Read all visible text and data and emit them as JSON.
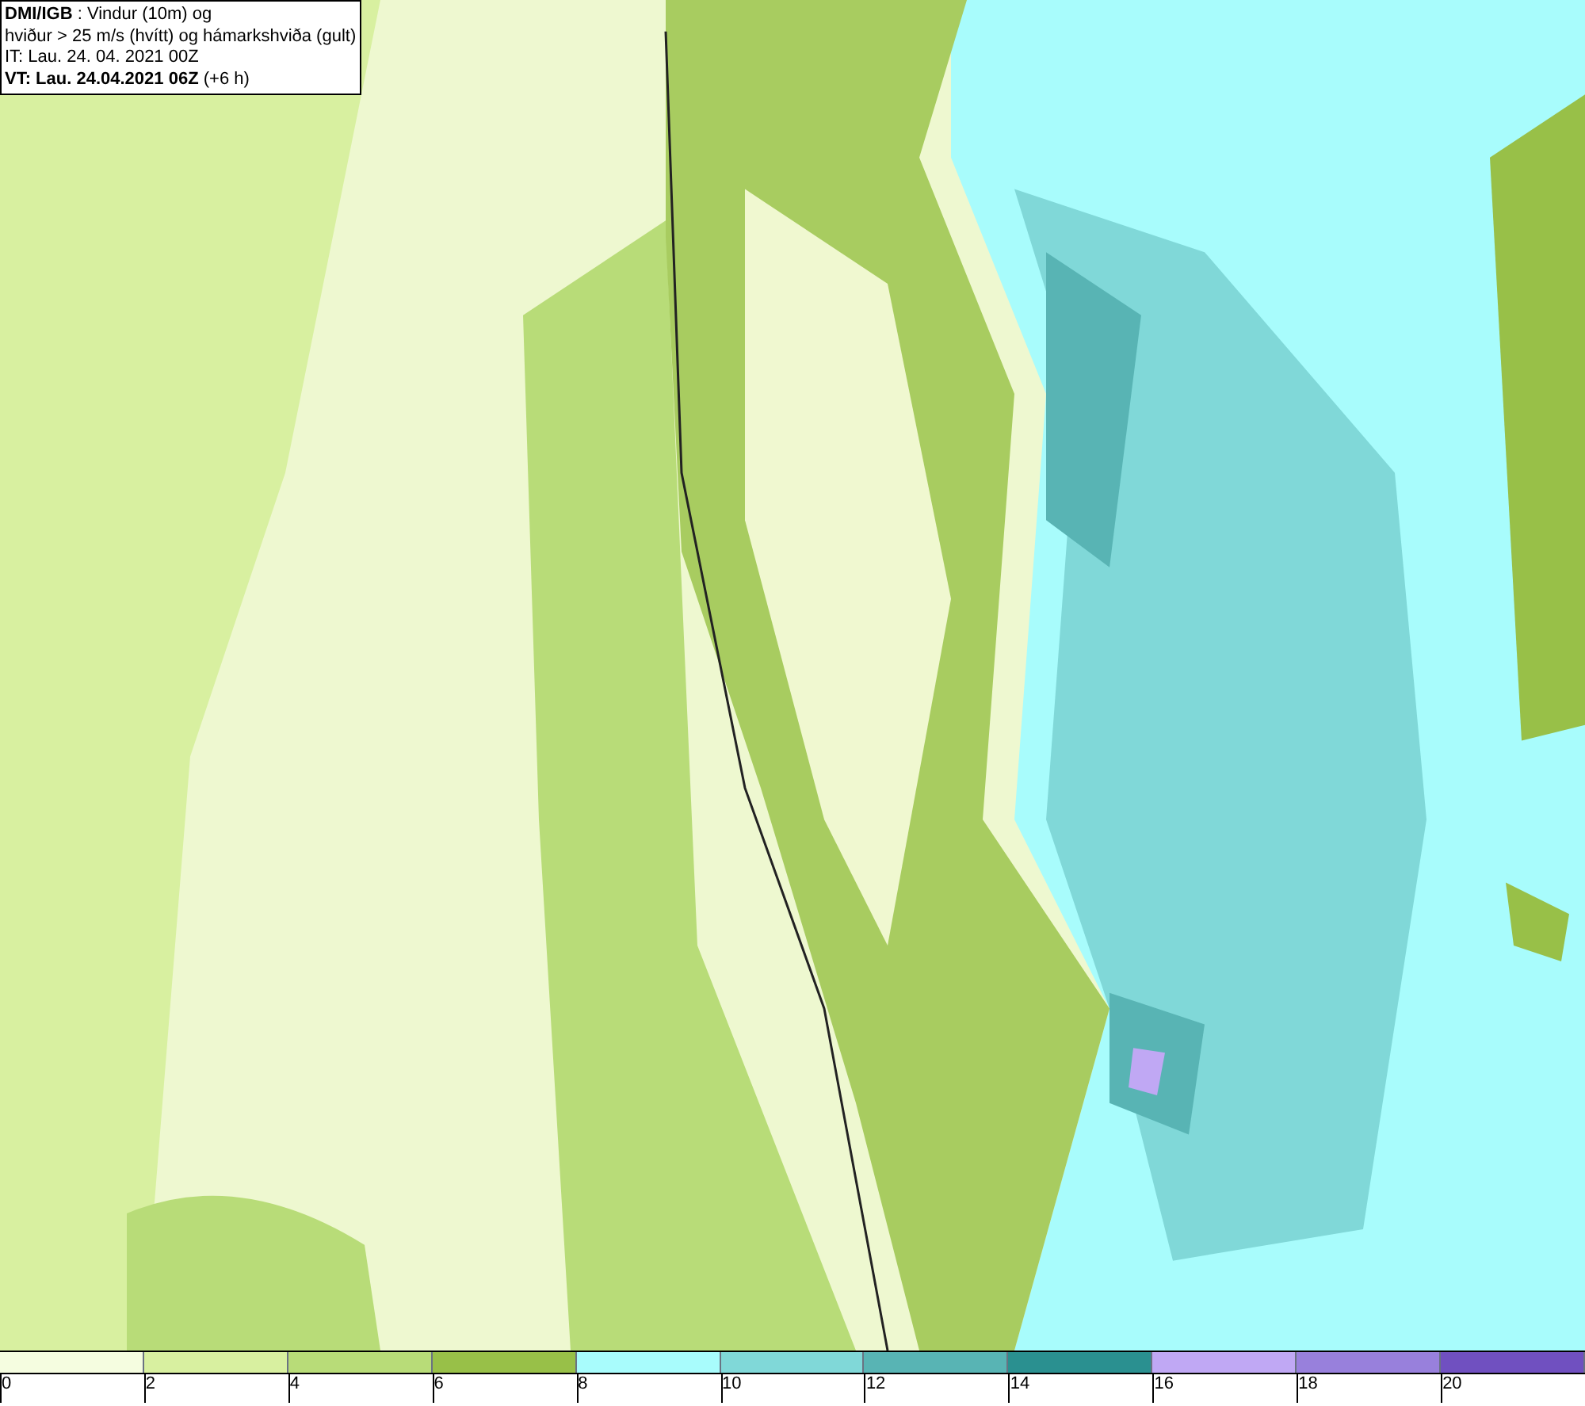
{
  "header": {
    "lines": [
      "**DMI/IGB** : Vindur (10m) og",
      "hviður > 25 m/s (hvítt) og hámarkshviða (gult)",
      "IT: Lau. 24. 04. 2021 00Z",
      "**VT: Lau. 24.04.2021 06Z** (+6 h)"
    ]
  },
  "legend": {
    "items": [
      {
        "color": "#f5fde0",
        "label": "0"
      },
      {
        "color": "#d8f0a0",
        "label": "2"
      },
      {
        "color": "#b8dc78",
        "label": "4"
      },
      {
        "color": "#98c048",
        "label": "6"
      },
      {
        "color": "#a8fcfc",
        "label": "8"
      },
      {
        "color": "#80d8d8",
        "label": "10"
      },
      {
        "color": "#58b4b4",
        "label": "12"
      },
      {
        "color": "#2a9090",
        "label": "14"
      },
      {
        "color": "#c0a8f4",
        "label": "16"
      },
      {
        "color": "#9880dc",
        "label": "18"
      },
      {
        "color": "#7050c0",
        "label": "20"
      }
    ]
  }
}
